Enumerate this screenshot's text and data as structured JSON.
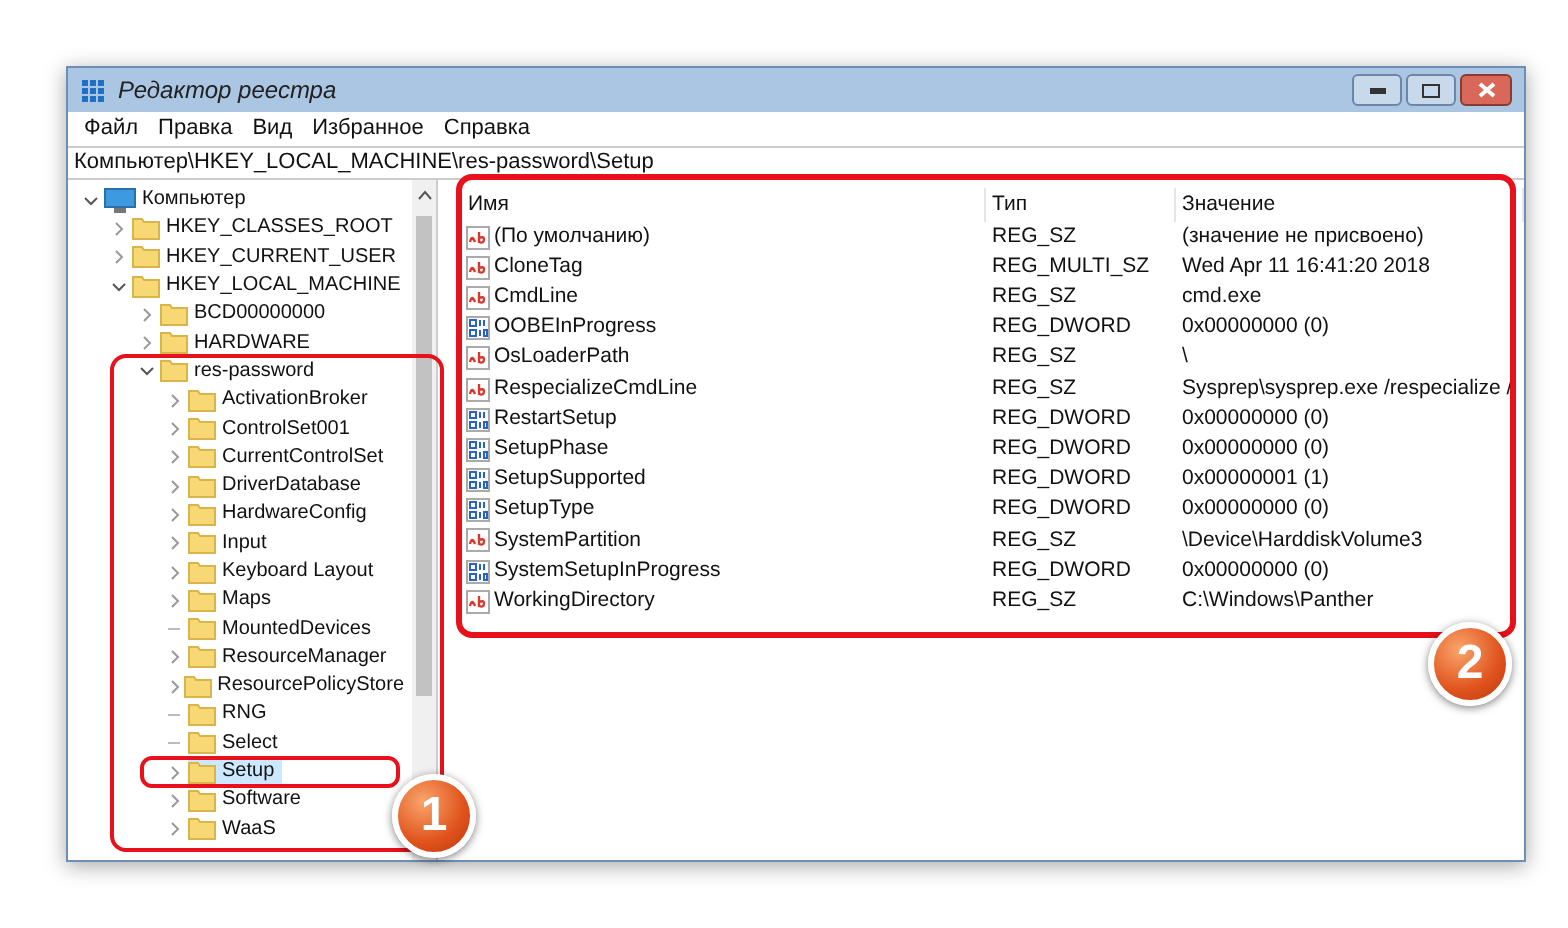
{
  "window": {
    "title": "Редактор реестра"
  },
  "menu": [
    "Файл",
    "Правка",
    "Вид",
    "Избранное",
    "Справка"
  ],
  "address": "Компьютер\\HKEY_LOCAL_MACHINE\\res-password\\Setup",
  "tree": [
    {
      "label": "Компьютер",
      "kind": "computer",
      "expanded": true,
      "expandable": true,
      "selected": false,
      "children": [
        {
          "label": "HKEY_CLASSES_ROOT",
          "kind": "folder",
          "expanded": false,
          "expandable": true,
          "selected": false
        },
        {
          "label": "HKEY_CURRENT_USER",
          "kind": "folder",
          "expanded": false,
          "expandable": true,
          "selected": false
        },
        {
          "label": "HKEY_LOCAL_MACHINE",
          "kind": "folder",
          "expanded": true,
          "expandable": true,
          "selected": false,
          "children": [
            {
              "label": "BCD00000000",
              "kind": "folder",
              "expanded": false,
              "expandable": true,
              "selected": false
            },
            {
              "label": "HARDWARE",
              "kind": "folder",
              "expanded": false,
              "expandable": true,
              "selected": false
            },
            {
              "label": "res-password",
              "kind": "folder",
              "expanded": true,
              "expandable": true,
              "selected": false,
              "children": [
                {
                  "label": "ActivationBroker",
                  "kind": "folder",
                  "expanded": false,
                  "expandable": true,
                  "selected": false
                },
                {
                  "label": "ControlSet001",
                  "kind": "folder",
                  "expanded": false,
                  "expandable": true,
                  "selected": false
                },
                {
                  "label": "CurrentControlSet",
                  "kind": "folder",
                  "expanded": false,
                  "expandable": true,
                  "selected": false
                },
                {
                  "label": "DriverDatabase",
                  "kind": "folder",
                  "expanded": false,
                  "expandable": true,
                  "selected": false
                },
                {
                  "label": "HardwareConfig",
                  "kind": "folder",
                  "expanded": false,
                  "expandable": true,
                  "selected": false
                },
                {
                  "label": "Input",
                  "kind": "folder",
                  "expanded": false,
                  "expandable": true,
                  "selected": false
                },
                {
                  "label": "Keyboard Layout",
                  "kind": "folder",
                  "expanded": false,
                  "expandable": true,
                  "selected": false
                },
                {
                  "label": "Maps",
                  "kind": "folder",
                  "expanded": false,
                  "expandable": true,
                  "selected": false
                },
                {
                  "label": "MountedDevices",
                  "kind": "folder",
                  "expanded": false,
                  "expandable": false,
                  "selected": false
                },
                {
                  "label": "ResourceManager",
                  "kind": "folder",
                  "expanded": false,
                  "expandable": true,
                  "selected": false
                },
                {
                  "label": "ResourcePolicyStore",
                  "kind": "folder",
                  "expanded": false,
                  "expandable": true,
                  "selected": false
                },
                {
                  "label": "RNG",
                  "kind": "folder",
                  "expanded": false,
                  "expandable": false,
                  "selected": false
                },
                {
                  "label": "Select",
                  "kind": "folder",
                  "expanded": false,
                  "expandable": false,
                  "selected": false
                },
                {
                  "label": "Setup",
                  "kind": "folder",
                  "expanded": false,
                  "expandable": true,
                  "selected": true
                },
                {
                  "label": "Software",
                  "kind": "folder",
                  "expanded": false,
                  "expandable": true,
                  "selected": false
                },
                {
                  "label": "WaaS",
                  "kind": "folder",
                  "expanded": false,
                  "expandable": true,
                  "selected": false
                }
              ]
            }
          ]
        }
      ]
    }
  ],
  "table": {
    "columns": [
      "Имя",
      "Тип",
      "Значение"
    ],
    "rows": [
      {
        "kind": "string",
        "name": "(По умолчанию)",
        "type": "REG_SZ",
        "value": "(значение не присвоено)"
      },
      {
        "kind": "string",
        "name": "CloneTag",
        "type": "REG_MULTI_SZ",
        "value": "Wed Apr 11 16:41:20 2018"
      },
      {
        "kind": "string",
        "name": "CmdLine",
        "type": "REG_SZ",
        "value": "cmd.exe"
      },
      {
        "kind": "binary",
        "name": "OOBEInProgress",
        "type": "REG_DWORD",
        "value": "0x00000000 (0)"
      },
      {
        "kind": "string",
        "name": "OsLoaderPath",
        "type": "REG_SZ",
        "value": "\\"
      },
      {
        "kind": "string",
        "name": "RespecializeCmdLine",
        "type": "REG_SZ",
        "value": "Sysprep\\sysprep.exe /respecialize /"
      },
      {
        "kind": "binary",
        "name": "RestartSetup",
        "type": "REG_DWORD",
        "value": "0x00000000 (0)"
      },
      {
        "kind": "binary",
        "name": "SetupPhase",
        "type": "REG_DWORD",
        "value": "0x00000000 (0)"
      },
      {
        "kind": "binary",
        "name": "SetupSupported",
        "type": "REG_DWORD",
        "value": "0x00000001 (1)"
      },
      {
        "kind": "binary",
        "name": "SetupType",
        "type": "REG_DWORD",
        "value": "0x00000000 (0)"
      },
      {
        "kind": "string",
        "name": "SystemPartition",
        "type": "REG_SZ",
        "value": "\\Device\\HarddiskVolume3"
      },
      {
        "kind": "binary",
        "name": "SystemSetupInProgress",
        "type": "REG_DWORD",
        "value": "0x00000000 (0)"
      },
      {
        "kind": "string",
        "name": "WorkingDirectory",
        "type": "REG_SZ",
        "value": "C:\\Windows\\Panther"
      }
    ]
  },
  "annotations": [
    "1",
    "2"
  ]
}
